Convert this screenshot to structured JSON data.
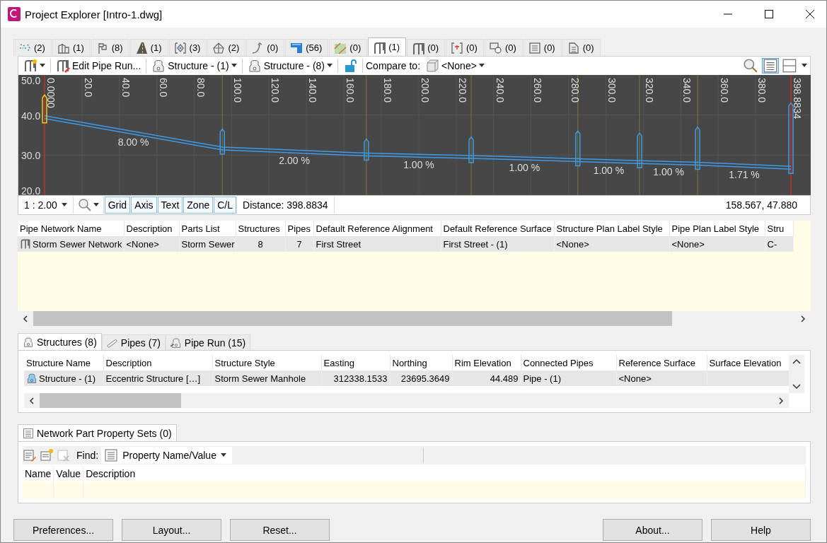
{
  "window": {
    "title": "Project Explorer [Intro-1.dwg]"
  },
  "object_tabs": [
    {
      "label": "(2)",
      "selected": false
    },
    {
      "label": "(1)",
      "selected": false
    },
    {
      "label": "(8)",
      "selected": false
    },
    {
      "label": "(1)",
      "selected": false
    },
    {
      "label": "(3)",
      "selected": false
    },
    {
      "label": "(2)",
      "selected": false
    },
    {
      "label": "(0)",
      "selected": false
    },
    {
      "label": "(56)",
      "selected": false
    },
    {
      "label": "(0)",
      "selected": false
    },
    {
      "label": "(1)",
      "selected": true
    },
    {
      "label": "(0)",
      "selected": false
    },
    {
      "label": "(0)",
      "selected": false
    },
    {
      "label": "(0)",
      "selected": false
    },
    {
      "label": "(0)",
      "selected": false
    },
    {
      "label": "(0)",
      "selected": false
    }
  ],
  "toolbar": {
    "edit_pipe_run": "Edit Pipe Run...",
    "structure_from": "Structure - (1)",
    "structure_to": "Structure - (8)",
    "compare_label": "Compare to:",
    "compare_value": "<None>"
  },
  "profile": {
    "elevation_labels": [
      "50.0",
      "40.0",
      "30.0",
      "20.0"
    ],
    "station_labels": [
      "0.0000",
      "20.0",
      "40.0",
      "60.0",
      "80.0",
      "100.0",
      "120.0",
      "140.0",
      "160.0",
      "180.0",
      "200.0",
      "220.0",
      "240.0",
      "260.0",
      "280.0",
      "300.0",
      "320.0",
      "340.0",
      "360.0",
      "380.0",
      "398.8834"
    ],
    "grade_labels": [
      "8.00 %",
      "2.00 %",
      "1.00 %",
      "1.00 %",
      "1.00 %",
      "1.00 %",
      "1.71 %"
    ]
  },
  "profile_status": {
    "scale": "1 : 2.00",
    "toggles": [
      {
        "label": "Grid",
        "on": true
      },
      {
        "label": "Axis",
        "on": true
      },
      {
        "label": "Text",
        "on": true
      },
      {
        "label": "Zone",
        "on": true
      },
      {
        "label": "C/L",
        "on": true
      }
    ],
    "distance": "Distance: 398.8834",
    "coordinates": "158.567, 47.880"
  },
  "network_table": {
    "columns": [
      "Pipe Network Name",
      "Description",
      "Parts List",
      "Structures",
      "Pipes",
      "Default Reference Alignment",
      "Default Reference Surface",
      "Structure Plan Label Style",
      "Pipe Plan Label Style",
      "Stru"
    ],
    "rows": [
      {
        "selected": true,
        "cells": [
          "Storm Sewer Network",
          "<None>",
          "Storm Sewer",
          "8",
          "7",
          "First Street",
          "First Street - (1)",
          "<None>",
          "<None>",
          "C-"
        ]
      }
    ]
  },
  "part_tabs": [
    {
      "label": "Structures (8)",
      "selected": true
    },
    {
      "label": "Pipes (7)",
      "selected": false
    },
    {
      "label": "Pipe Run (15)",
      "selected": false
    }
  ],
  "structures_table": {
    "columns": [
      "Structure Name",
      "Description",
      "Structure Style",
      "Easting",
      "Northing",
      "Rim Elevation",
      "Connected Pipes",
      "Reference Surface",
      "Surface Elevation"
    ],
    "rows": [
      {
        "selected": true,
        "cells": [
          "Structure - (1)",
          "Eccentric Structure  […]",
          "Storm Sewer Manhole",
          "312338.1533",
          "23695.3649",
          "44.489",
          "Pipe - (1)",
          "<None>",
          ""
        ]
      }
    ]
  },
  "property_sets": {
    "tab": "Network Part Property Sets (0)",
    "find_label": "Find:",
    "find_value": "Property Name/Value",
    "columns": [
      "Name",
      "Value",
      "Description"
    ]
  },
  "buttons": {
    "left": [
      "Preferences...",
      "Layout...",
      "Reset..."
    ],
    "right": [
      "About...",
      "Help"
    ]
  }
}
